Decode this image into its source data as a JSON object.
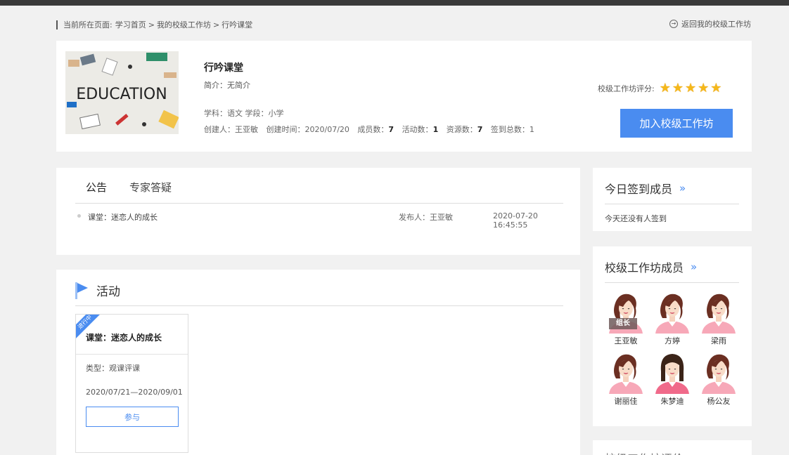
{
  "breadcrumb": {
    "prefix": "当前所在页面:",
    "items": [
      "学习首页",
      "我的校级工作坊",
      "行吟课堂"
    ],
    "separator": ">"
  },
  "back_link": {
    "label": "返回我的校级工作坊",
    "icon": "arrow-right-circle-icon"
  },
  "workshop": {
    "image_text": "EDUCATION",
    "title": "行吟课堂",
    "intro": "简介：无简介",
    "subject_stage": "学科：语文  学段：小学",
    "meta": {
      "creator_label": "创建人：",
      "creator": "王亚敏",
      "created_label": "创建时间：",
      "created": "2020/07/20",
      "members_label": "成员数：",
      "members": "7",
      "activities_label": "活动数：",
      "activities": "1",
      "resources_label": "资源数：",
      "resources": "7",
      "signins_label": "签到总数：",
      "signins": "1"
    },
    "rating_label": "校级工作坊评分:",
    "rating": 5,
    "join_label": "加入校级工作坊"
  },
  "notice": {
    "tabs": [
      "公告",
      "专家答疑"
    ],
    "active_tab": 0,
    "items": [
      {
        "title": "课堂：迷恋人的成长",
        "publisher": "发布人：王亚敏",
        "time": "2020-07-20 16:45:55"
      }
    ]
  },
  "activities": {
    "title": "活动",
    "items": [
      {
        "status": "进行中",
        "name": "课堂：迷恋人的成长",
        "type": "类型：观课评课",
        "dates": "2020/07/21—2020/09/01",
        "join_label": "参与"
      }
    ]
  },
  "today_signin": {
    "title": "今日签到成员",
    "more": "»",
    "empty_text": "今天还没有人签到"
  },
  "members": {
    "title": "校级工作坊成员",
    "more": "»",
    "leader_tag": "组长",
    "list": [
      {
        "name": "王亚敏",
        "avatar": "female-avatar",
        "leader": true
      },
      {
        "name": "方婷",
        "avatar": "female-avatar",
        "leader": false
      },
      {
        "name": "梁雨",
        "avatar": "female-avatar",
        "leader": false
      },
      {
        "name": "谢丽佳",
        "avatar": "female-avatar",
        "leader": false
      },
      {
        "name": "朱梦迪",
        "avatar": "female-avatar-bangs",
        "leader": false
      },
      {
        "name": "杨公友",
        "avatar": "female-avatar",
        "leader": false
      }
    ]
  },
  "workshop_review": {
    "title": "校级工作坊评价"
  },
  "colors": {
    "accent": "#4a8cf0",
    "star": "#f5b81a",
    "topbar": "#3a3a3a"
  }
}
